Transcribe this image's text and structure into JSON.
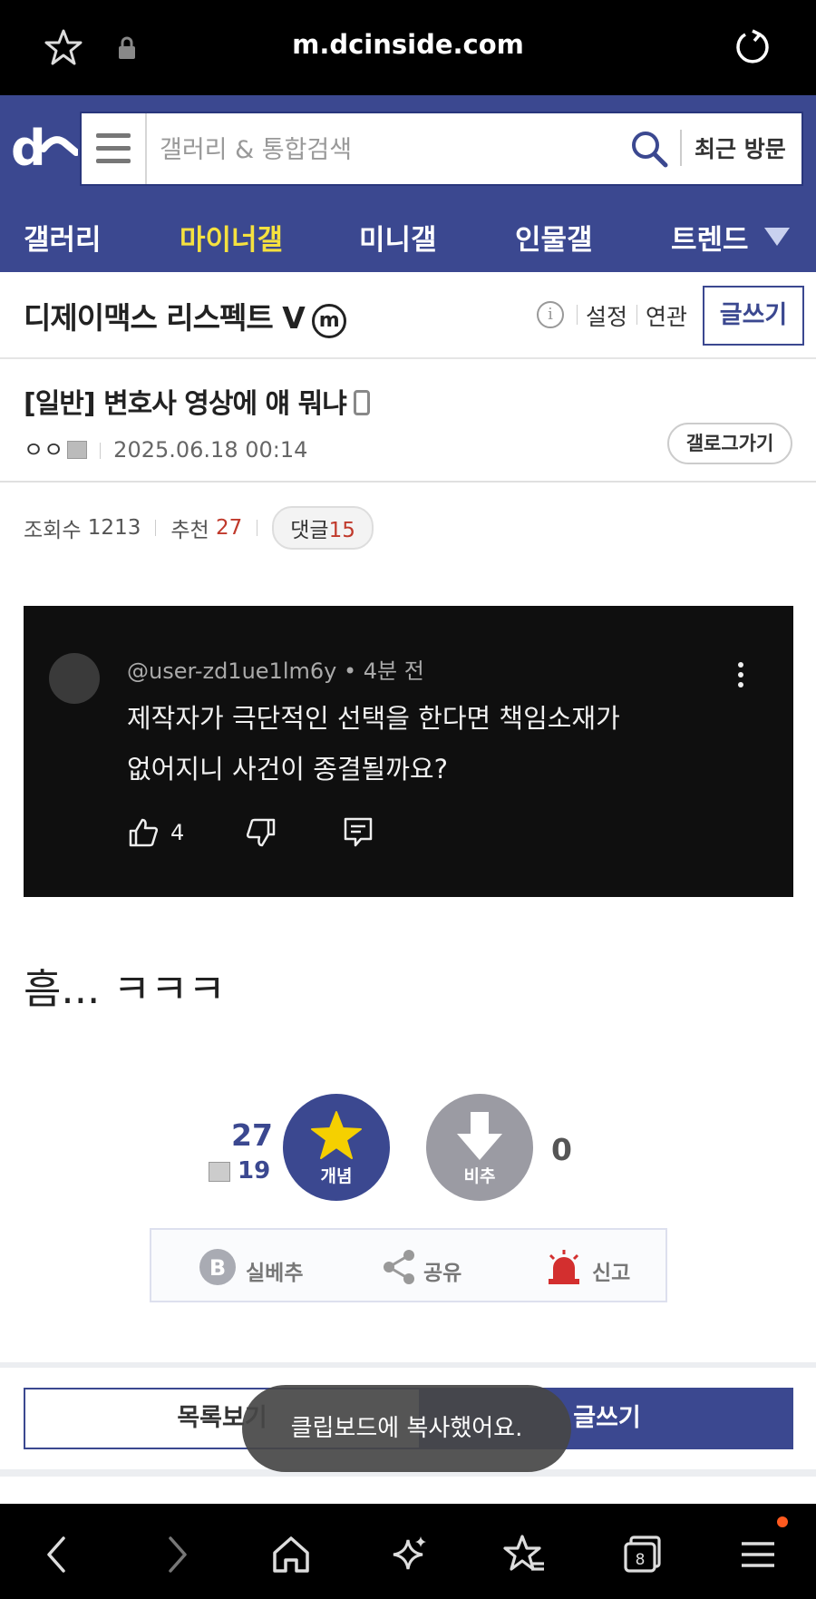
{
  "browser": {
    "url": "m.dcinside.com",
    "icons": [
      "star-icon",
      "lock-icon",
      "reload-icon"
    ]
  },
  "header": {
    "search_placeholder": "갤러리 & 통합검색",
    "recent_label": "최근 방문"
  },
  "gallery_nav": {
    "items": [
      {
        "label": "갤러리",
        "active": false
      },
      {
        "label": "마이너갤",
        "active": true
      },
      {
        "label": "미니갤",
        "active": false
      },
      {
        "label": "인물갤",
        "active": false
      },
      {
        "label": "트렌드",
        "active": false
      }
    ]
  },
  "gallery": {
    "title": "디제이맥스 리스펙트 V",
    "badge": "m",
    "links": [
      "설정",
      "연관"
    ],
    "write_label": "글쓰기"
  },
  "post": {
    "title": "[일반] 변호사 영상에 얘 뭐냐",
    "author": "ㅇㅇ",
    "date": "2025.06.18 00:14",
    "gallog_label": "갤로그가기",
    "views_label": "조회수",
    "views": "1213",
    "recommend_label": "추천",
    "recommend": "27",
    "comments_label": "댓글",
    "comments": "15",
    "body": "흠... ㅋㅋㅋ"
  },
  "embedded_comment": {
    "user": "@user-zd1ue1lm6y",
    "time": "4분 전",
    "text_line1": "제작자가 극단적인 선택을 한다면 책임소재가",
    "text_line2": "없어지니 사건이 종결될까요?",
    "likes": "4"
  },
  "recommend_box": {
    "up_count": "27",
    "fixed_count": "19",
    "up_label": "개념",
    "down_label": "비추",
    "down_count": "0"
  },
  "share_bar": {
    "items": [
      "실베추",
      "공유",
      "신고"
    ]
  },
  "bottom_buttons": {
    "list_label": "목록보기",
    "write_label": "글쓰기"
  },
  "toast": "클립보드에 복사했어요.",
  "browser_nav": {
    "tabs_count": "8"
  },
  "colors": {
    "brand": "#3b4890",
    "active_nav": "#f5e13f",
    "red": "#c0392b"
  }
}
